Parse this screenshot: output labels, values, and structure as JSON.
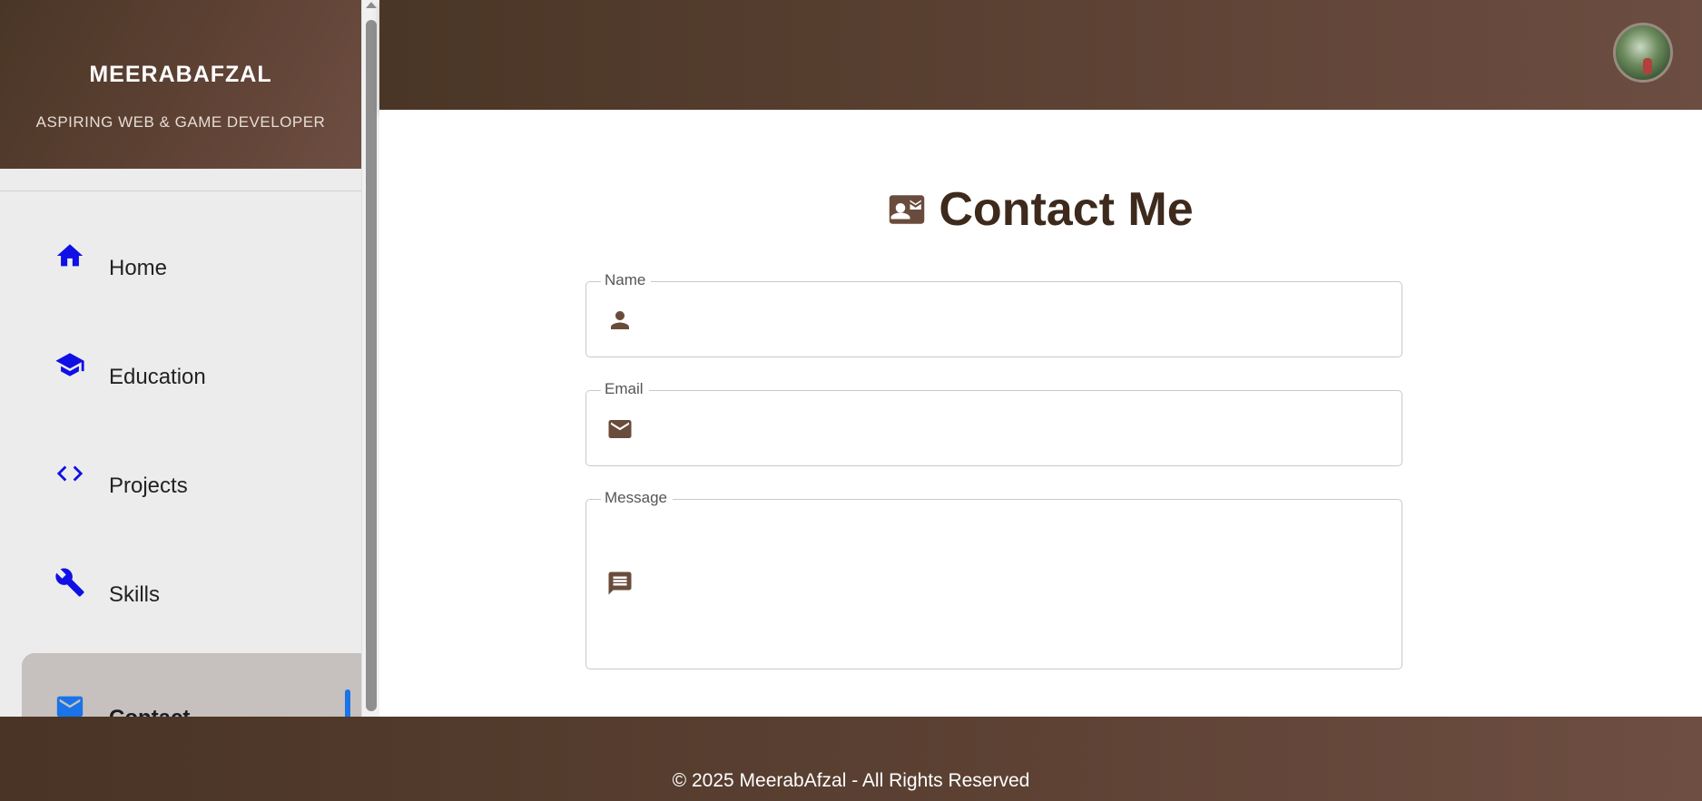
{
  "sidebar": {
    "site_name": "MEERABAFZAL",
    "tagline": "ASPIRING WEB & GAME DEVELOPER",
    "items": [
      {
        "label": "Home",
        "icon": "home-icon"
      },
      {
        "label": "Education",
        "icon": "graduation-cap-icon"
      },
      {
        "label": "Projects",
        "icon": "code-icon"
      },
      {
        "label": "Skills",
        "icon": "wrench-icon"
      },
      {
        "label": "Contact",
        "icon": "mail-icon",
        "active": true
      }
    ]
  },
  "topbar": {
    "avatar": "profile-photo"
  },
  "main": {
    "title": "Contact Me",
    "title_icon": "contact-card-icon",
    "fields": {
      "name": {
        "label": "Name",
        "value": "",
        "icon": "person-icon"
      },
      "email": {
        "label": "Email",
        "value": "",
        "icon": "mail-icon"
      },
      "message": {
        "label": "Message",
        "value": "",
        "icon": "chat-icon"
      }
    }
  },
  "footer": {
    "text": "© 2025 MeerabAfzal - All Rights Reserved"
  },
  "colors": {
    "brown_dark": "#4a3626",
    "brown_light": "#6e4e42",
    "nav_icon": "#0f0fe6",
    "active_accent": "#1a73e8",
    "field_icon": "#6a4c3c",
    "title": "#3d2a1c"
  }
}
